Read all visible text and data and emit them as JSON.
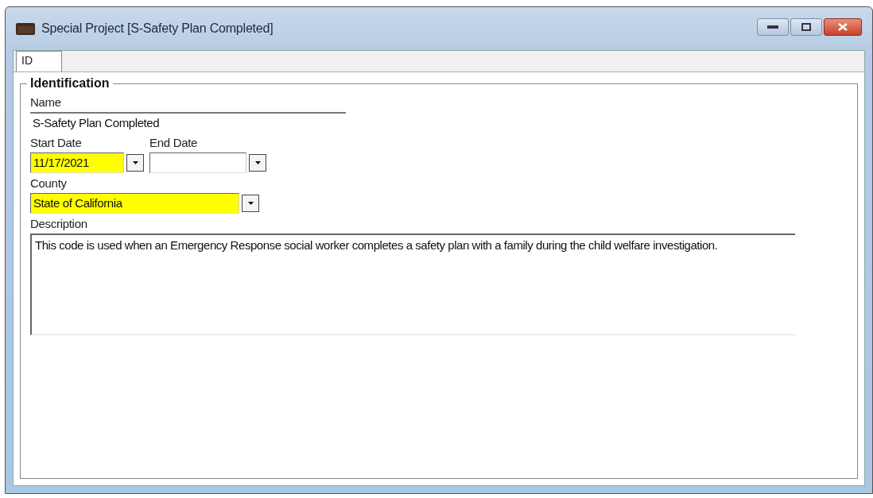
{
  "window": {
    "title": "Special Project [S-Safety Plan Completed]"
  },
  "tabs": [
    {
      "label": "ID",
      "selected": true
    }
  ],
  "group": {
    "title": "Identification",
    "name": {
      "label": "Name",
      "value": "S-Safety Plan Completed",
      "highlighted": false
    },
    "start_date": {
      "label": "Start Date",
      "value": "11/17/2021",
      "highlighted": true
    },
    "end_date": {
      "label": "End Date",
      "highlighted": false
    },
    "county": {
      "label": "County",
      "value": "State of California",
      "highlighted": true
    },
    "description": {
      "label": "Description",
      "value": "This code is used when an Emergency Response social worker completes a safety plan with a family during the child welfare investigation."
    }
  }
}
